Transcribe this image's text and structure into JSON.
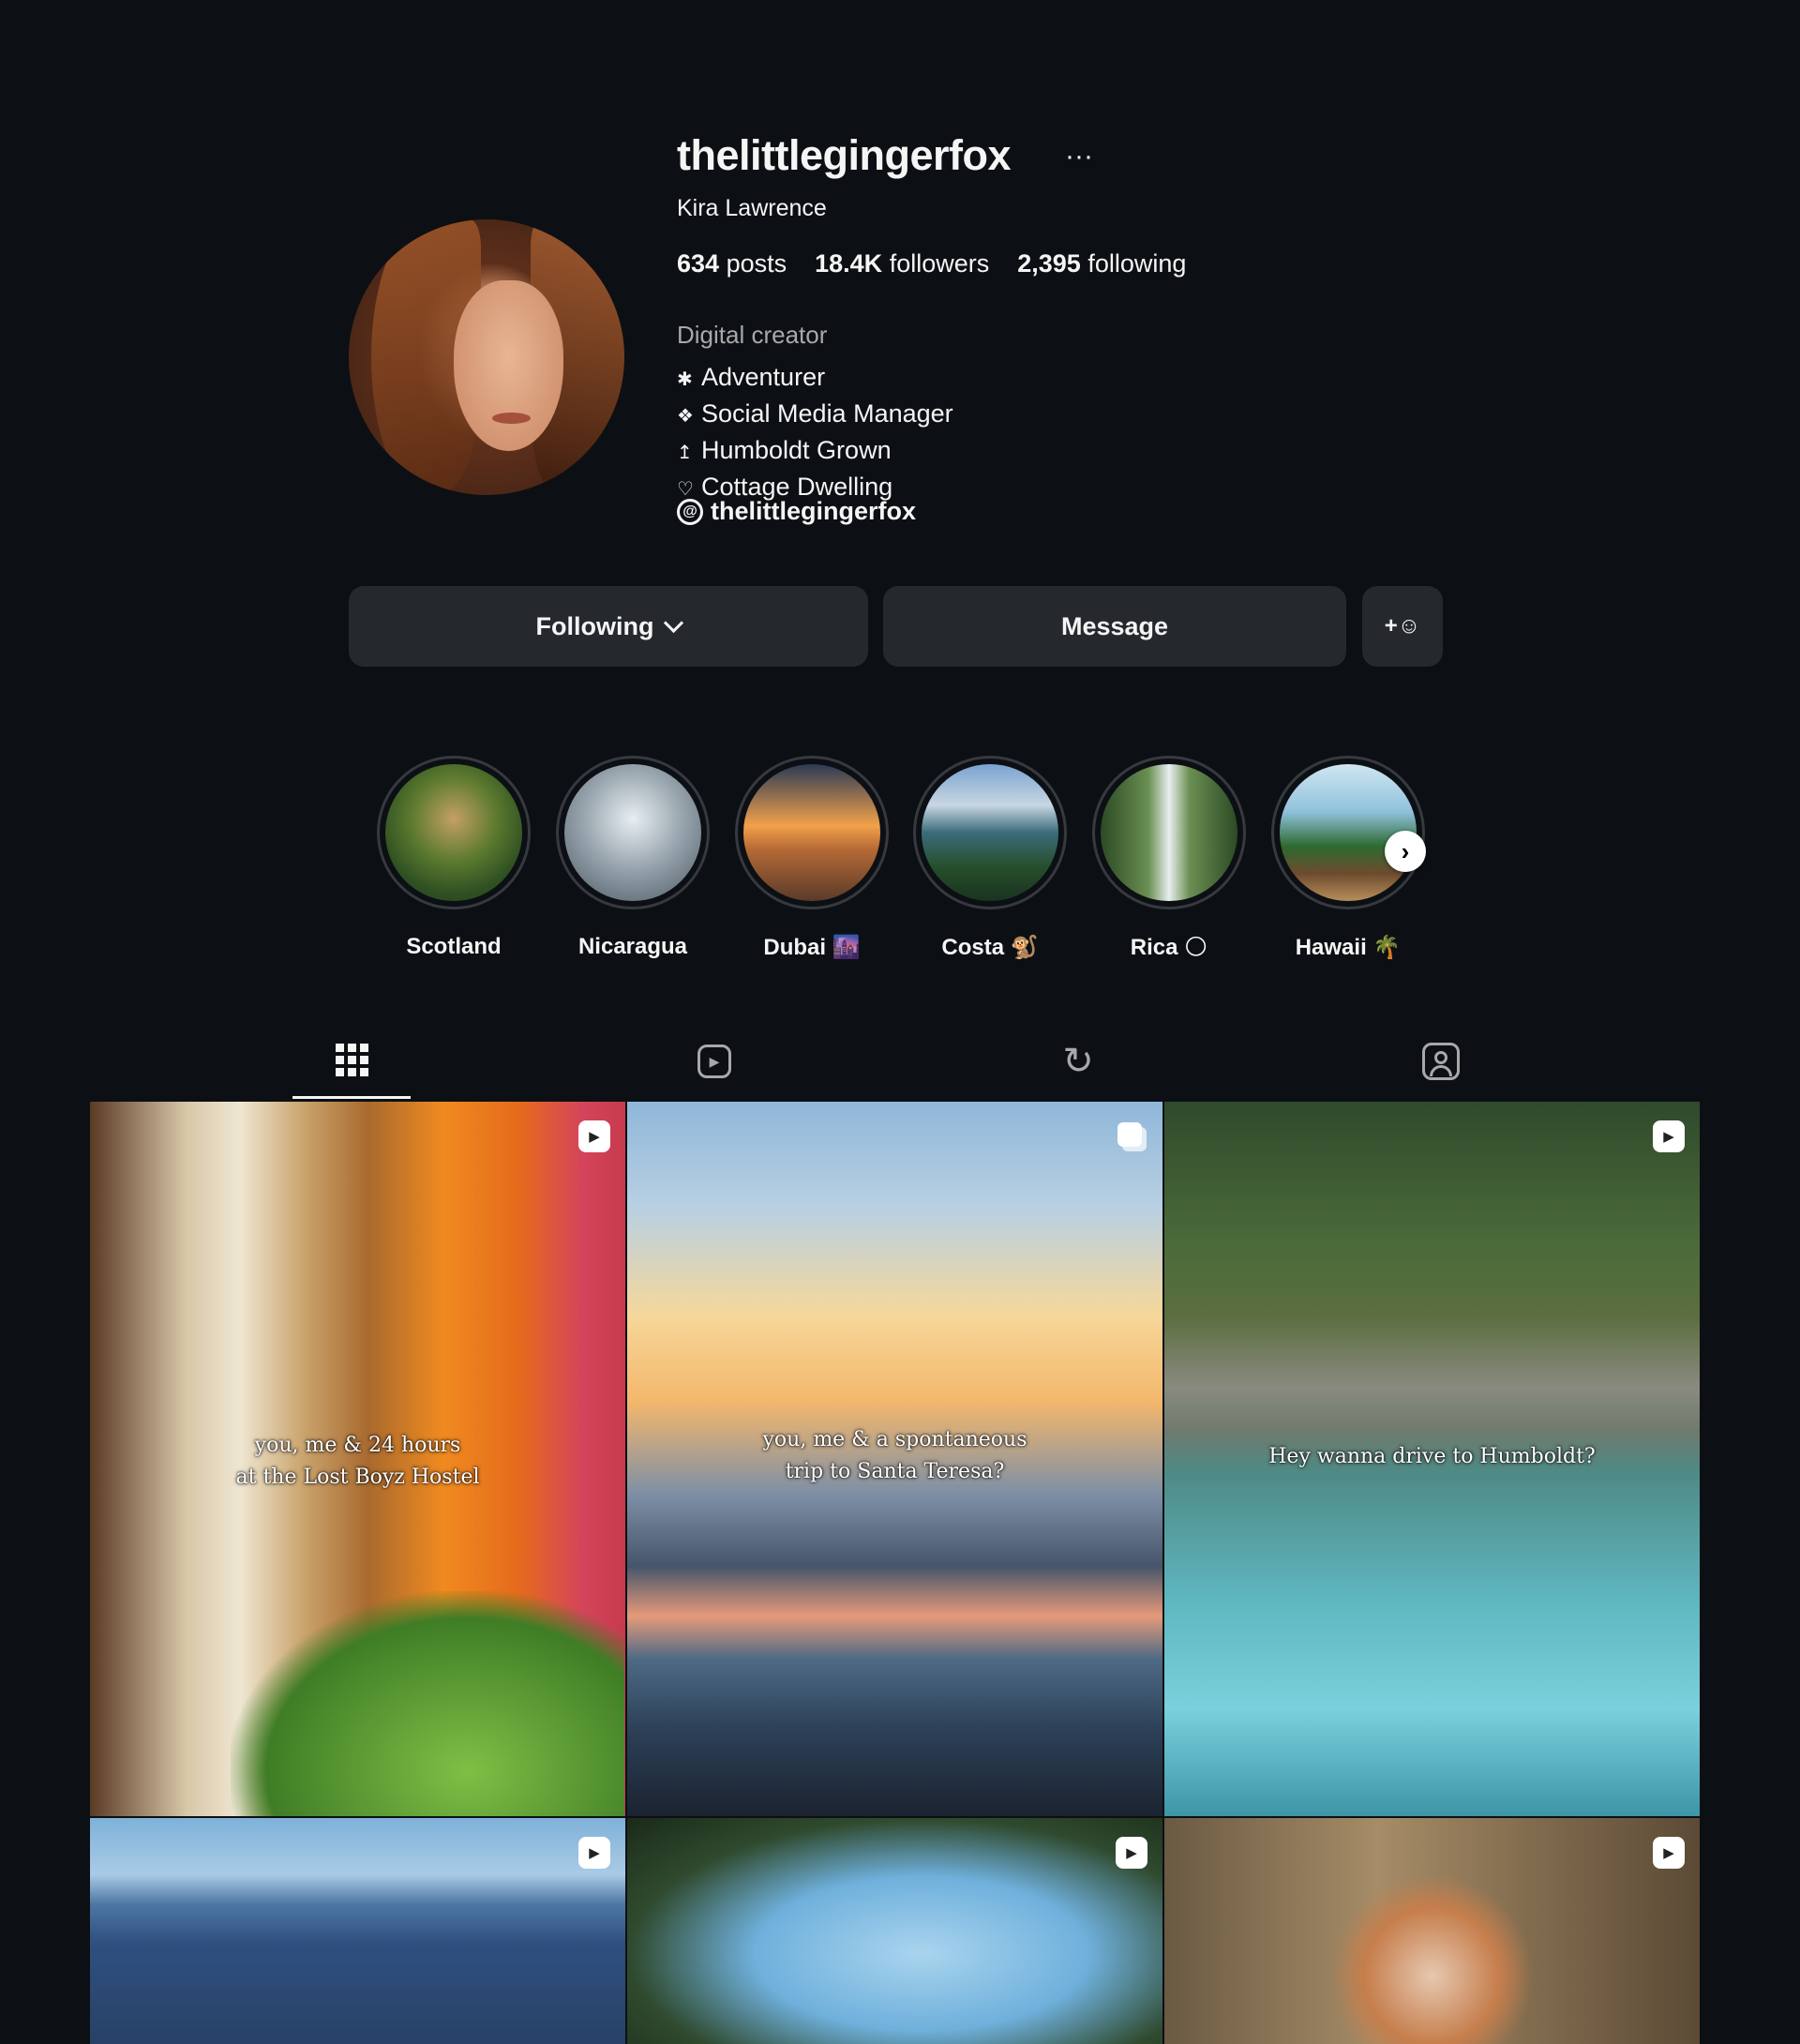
{
  "profile": {
    "username": "thelittlegingerfox",
    "more_icon": "···",
    "full_name": "Kira Lawrence",
    "stats": {
      "posts_count": "634",
      "posts_label": "posts",
      "followers_count": "18.4K",
      "followers_label": "followers",
      "following_count": "2,395",
      "following_label": "following"
    },
    "category": "Digital creator",
    "bio": [
      {
        "glyph": "✱",
        "text": "Adventurer"
      },
      {
        "glyph": "❖",
        "text": "Social Media Manager"
      },
      {
        "glyph": "↥",
        "text": "Humboldt Grown"
      },
      {
        "glyph": "♡",
        "text": "Cottage Dwelling"
      }
    ],
    "threads_handle": "thelittlegingerfox"
  },
  "actions": {
    "following_label": "Following",
    "message_label": "Message",
    "add_user_icon": "+☺"
  },
  "highlights": [
    {
      "label": "Scotland"
    },
    {
      "label": "Nicaragua"
    },
    {
      "label": "Dubai 🌆"
    },
    {
      "label": "Costa 🐒"
    },
    {
      "label": "Rica 🌕"
    },
    {
      "label": "Hawaii 🌴"
    }
  ],
  "highlights_next_icon": "›",
  "tabs": [
    {
      "name": "posts-tab",
      "icon": "grid-icon",
      "active": true
    },
    {
      "name": "reels-tab",
      "icon": "reels-icon",
      "active": false
    },
    {
      "name": "reposts-tab",
      "icon": "repost-icon",
      "active": false
    },
    {
      "name": "tagged-tab",
      "icon": "tagged-icon",
      "active": false
    }
  ],
  "posts": [
    {
      "caption_line1": "you, me & 24 hours",
      "caption_line2": "at the Lost Boyz Hostel",
      "type": "reel",
      "type_icon": "▶"
    },
    {
      "caption_line1": "you, me & a spontaneous",
      "caption_line2": "trip to Santa Teresa?",
      "type": "carousel",
      "type_icon": ""
    },
    {
      "caption_line1": "Hey wanna drive to Humboldt?",
      "caption_line2": "",
      "type": "reel",
      "type_icon": "▶"
    },
    {
      "caption_line1": "",
      "caption_line2": "",
      "type": "reel",
      "type_icon": "▶"
    },
    {
      "caption_line1": "",
      "caption_line2": "",
      "type": "reel",
      "type_icon": "▶"
    },
    {
      "caption_line1": "",
      "caption_line2": "",
      "type": "reel",
      "type_icon": "▶"
    }
  ]
}
